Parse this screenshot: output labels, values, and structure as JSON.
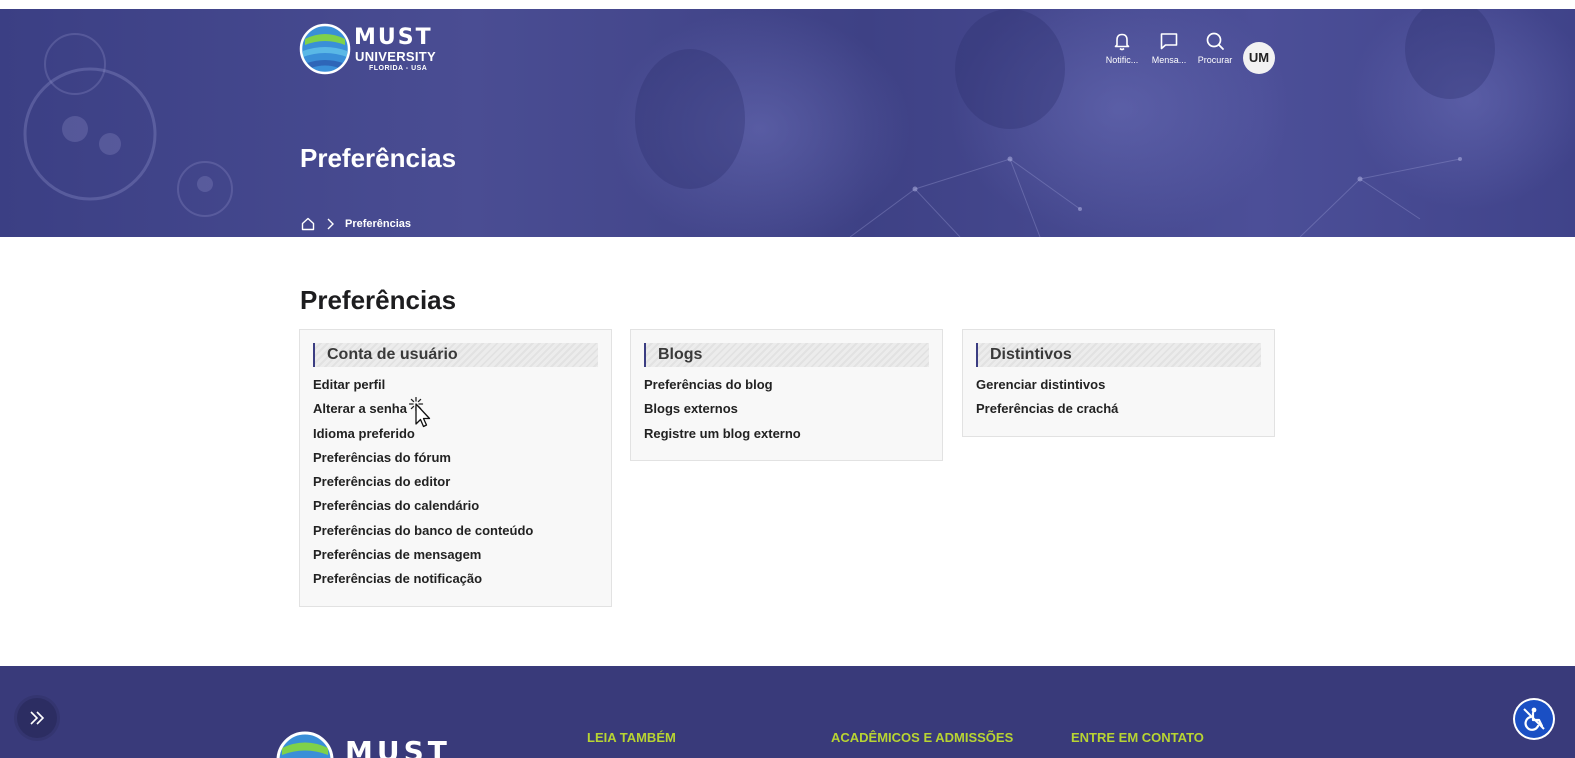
{
  "header": {
    "logo": {
      "word": "MUST",
      "line1": "UNIVERSITY",
      "line2": "FLORIDA - USA"
    },
    "nav": [
      {
        "label": "Notific...",
        "icon": "bell-icon"
      },
      {
        "label": "Mensa...",
        "icon": "message-icon"
      },
      {
        "label": "Procurar",
        "icon": "search-icon"
      }
    ],
    "avatar_initials": "UM"
  },
  "hero": {
    "title": "Preferências",
    "breadcrumb": {
      "home_icon": "home-icon",
      "separator_icon": "chevron-right-icon",
      "current": "Preferências"
    }
  },
  "main": {
    "title": "Preferências",
    "cards": [
      {
        "title": "Conta de usuário",
        "links": [
          "Editar perfil",
          "Alterar a senha",
          "Idioma preferido",
          "Preferências do fórum",
          "Preferências do editor",
          "Preferências do calendário",
          "Preferências do banco de conteúdo",
          "Preferências de mensagem",
          "Preferências de notificação"
        ]
      },
      {
        "title": "Blogs",
        "links": [
          "Preferências do blog",
          "Blogs externos",
          "Registre um blog externo"
        ]
      },
      {
        "title": "Distintivos",
        "links": [
          "Gerenciar distintivos",
          "Preferências de crachá"
        ]
      }
    ]
  },
  "footer": {
    "logo": {
      "word": "MUST"
    },
    "headings": [
      "LEIA TAMBÉM",
      "ACADÊMICOS E ADMISSÕES",
      "ENTRE EM CONTATO"
    ]
  },
  "widgets": {
    "drawer_toggle_icon": "double-chevron-right-icon",
    "accessibility_icon": "wheelchair-icon"
  },
  "colors": {
    "hero_bg": "#40438a",
    "footer_bg": "#393a7a",
    "footer_heading": "#b8d432",
    "card_accent": "#3b3d82",
    "accessibility_button": "#1a4fc4"
  }
}
